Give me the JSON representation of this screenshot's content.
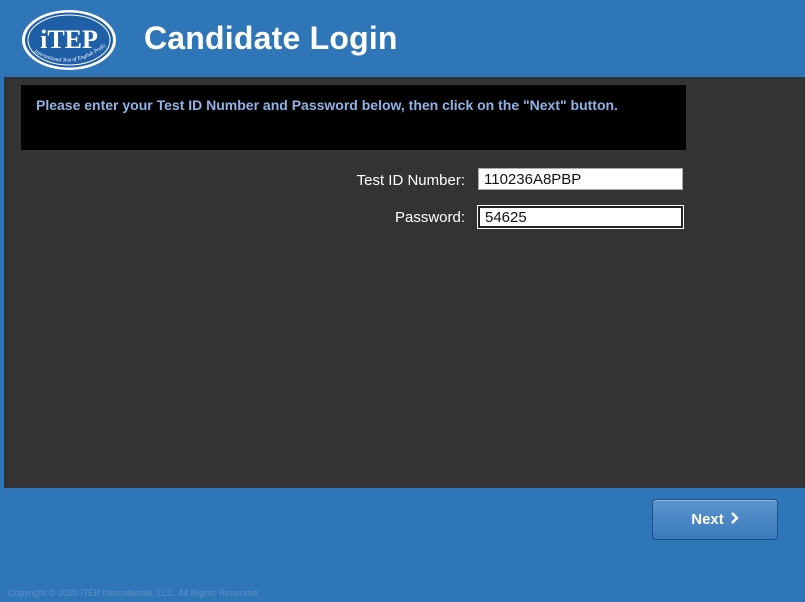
{
  "header": {
    "logo_text": "iTEP",
    "logo_subtext": "International Test of English Proficiency",
    "title": "Candidate Login"
  },
  "main": {
    "instructions": "Please enter your Test ID Number and Password below, then click on the \"Next\" button.",
    "fields": {
      "test_id_label": "Test ID Number:",
      "test_id_value": "110236A8PBP",
      "password_label": "Password:",
      "password_value": "54625"
    }
  },
  "footer": {
    "next_label": "Next",
    "next_icon": "chevron-right-icon",
    "copyright": "Copyright © 2020 iTEP International, LLC. All Rights Reserved."
  },
  "colors": {
    "brand_blue": "#2f76b8",
    "panel_dark": "#333333",
    "instruction_text": "#8fb3e6"
  }
}
